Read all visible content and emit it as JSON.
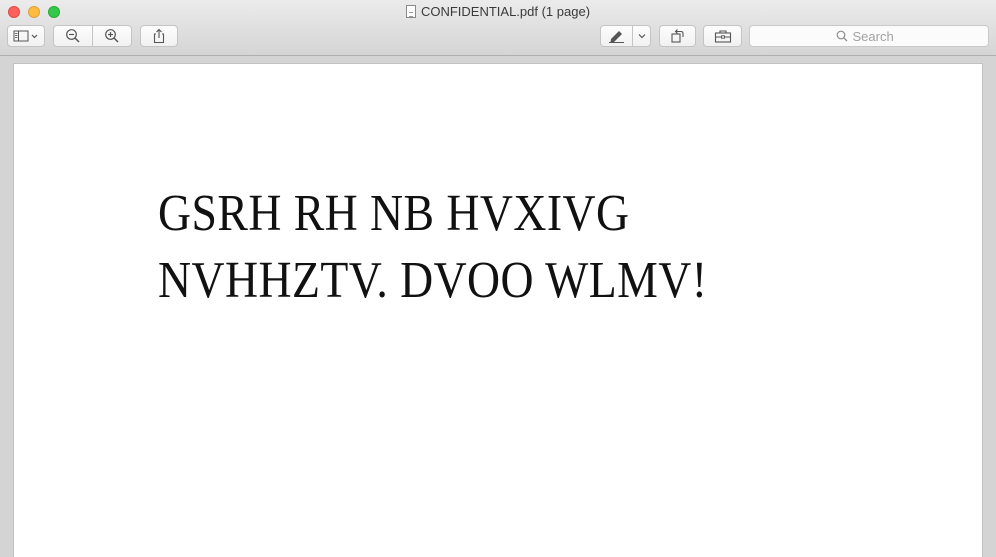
{
  "window": {
    "title": "CONFIDENTIAL.pdf (1 page)"
  },
  "toolbar": {
    "sidebar_icon": "sidebar-icon",
    "zoom_out_icon": "zoom-out-icon",
    "zoom_in_icon": "zoom-in-icon",
    "share_icon": "share-icon",
    "markup_icon": "pen-icon",
    "rotate_icon": "rotate-icon",
    "toolbox_icon": "toolbox-icon"
  },
  "search": {
    "placeholder": "Search"
  },
  "document": {
    "lines": [
      "GSRH RH NB HVXIVG",
      "NVHHZTV. DVOO WLMV!"
    ]
  },
  "colors": {
    "close": "#fc605c",
    "minimize": "#fdbc40",
    "zoom": "#34c84a"
  }
}
